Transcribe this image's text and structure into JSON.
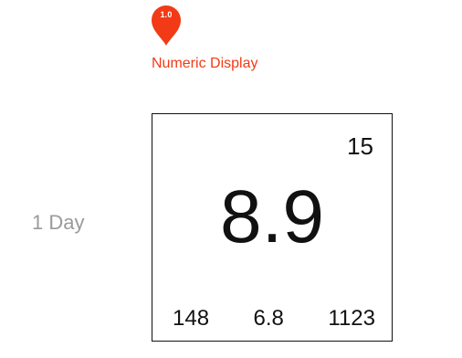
{
  "marker": {
    "version": "1.0",
    "color": "#f23a16",
    "icon": "map-pin-icon"
  },
  "caption": "Numeric Display",
  "range_label": "1 Day",
  "display": {
    "corner_value": "15",
    "main_value": "8.9",
    "sub_values": [
      "148",
      "6.8",
      "1123"
    ]
  }
}
